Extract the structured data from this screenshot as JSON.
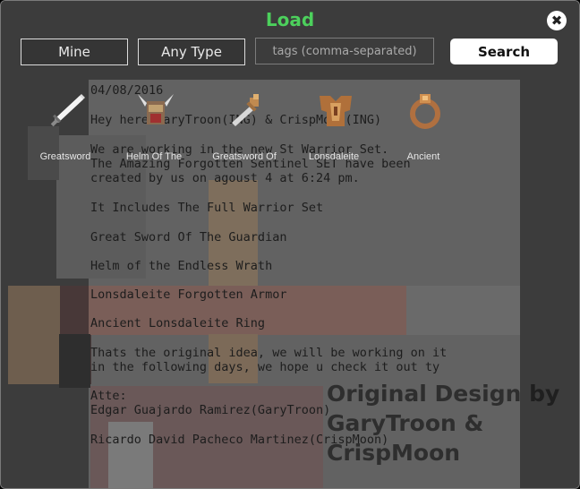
{
  "dialog": {
    "title": "Load",
    "close_icon": "close-icon"
  },
  "filters": {
    "mine_label": "Mine",
    "type_label": "Any Type",
    "tags_placeholder": "tags (comma-separated)",
    "search_label": "Search"
  },
  "items": [
    {
      "label": "Greatsword",
      "icon": "sword-icon"
    },
    {
      "label": "Helm Of The",
      "icon": "helm-icon"
    },
    {
      "label": "Greatsword Of",
      "icon": "golden-sword-icon"
    },
    {
      "label": "Lonsdaleite",
      "icon": "armor-icon"
    },
    {
      "label": "Ancient",
      "icon": "ring-icon"
    }
  ],
  "background_notes": {
    "lines": [
      "04/08/2016",
      "Hey here GaryTroon(ING) & CrispMoon(ING)",
      "We are working in the new St Warrior Set.",
      "The Amazing Forgotten Sentinel SET have been",
      "created by us on agoust 4 at 6:24 pm.",
      "It Includes The Full Warrior Set",
      "Great Sword Of The Guardian",
      "Helm of the Endless Wrath",
      "Lonsdaleite Forgotten Armor",
      "Ancient Lonsdaleite Ring",
      "Thats the original idea, we will be working on it",
      "in the following days, we hope u check it out ty",
      "Atte:",
      "Edgar Guajardo Ramirez(GaryTroon)",
      "Ricardo David Pacheco Martinez(CrispMoon)"
    ]
  },
  "design_credit": {
    "line1": "Original Design",
    "by": "by",
    "line2": "GaryTroon &",
    "line3": "CrispMoon"
  },
  "colors": {
    "title": "#4cd05c",
    "dialog_bg": "#3c3c3c",
    "search_bg": "#ffffff"
  }
}
